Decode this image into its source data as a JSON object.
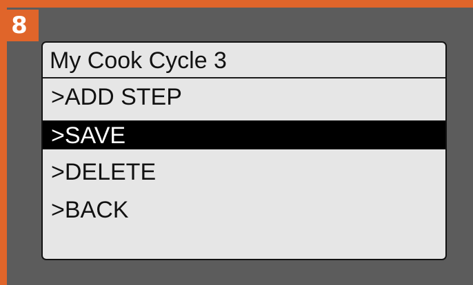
{
  "step_badge": "8",
  "screen": {
    "title": "My Cook Cycle 3",
    "menu": [
      {
        "label": ">ADD STEP",
        "selected": false
      },
      {
        "label": ">SAVE",
        "selected": true
      },
      {
        "label": ">DELETE",
        "selected": false
      },
      {
        "label": ">BACK",
        "selected": false
      }
    ]
  },
  "colors": {
    "accent": "#e0652a",
    "bezel": "#5c5c5c",
    "screen_bg": "#e6e6e6",
    "highlight_bg": "#000000",
    "highlight_text": "#ffffff"
  }
}
